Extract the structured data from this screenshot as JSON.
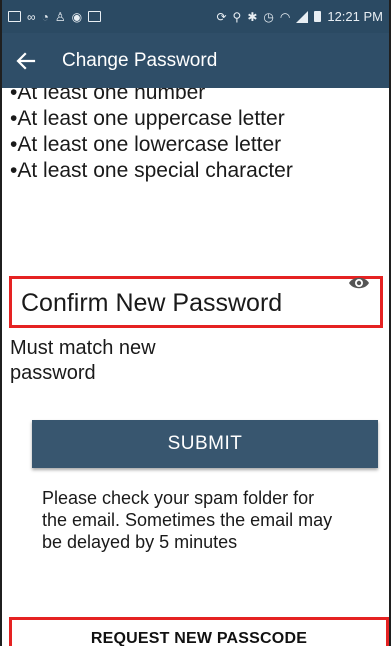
{
  "status_bar": {
    "left_icons": [
      "gallery-icon",
      "voicemail-icon",
      "wifi-call-icon",
      "person-icon",
      "location-icon",
      "image-icon"
    ],
    "right_icons": [
      "sync-icon",
      "location-pin-icon",
      "bluetooth-icon",
      "alarm-icon",
      "wifi-icon",
      "signal-icon",
      "battery-icon"
    ],
    "time": "12:21 PM"
  },
  "app_bar": {
    "back_icon": "arrow-left-icon",
    "title": "Change Password"
  },
  "password_rules": {
    "items": [
      "•At least one number",
      "•At least one uppercase letter",
      "•At least one lowercase letter",
      "•At least one special character"
    ]
  },
  "confirm_field": {
    "label": "Confirm New Password",
    "toggle_icon": "eye-icon",
    "hint": "Must match new password"
  },
  "submit": {
    "label": "SUBMIT"
  },
  "notice": {
    "text": "Please check your spam folder for the email. Sometimes the email may be delayed by 5 minutes"
  },
  "request": {
    "label": "REQUEST NEW PASSCODE"
  },
  "colors": {
    "app_bar": "#2f4e68",
    "button": "#38566f",
    "highlight": "#e52222"
  }
}
